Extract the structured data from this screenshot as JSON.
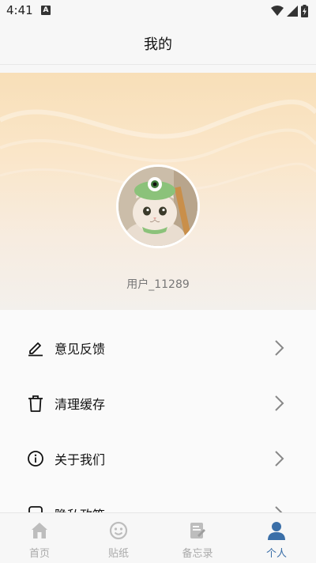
{
  "status_bar": {
    "time": "4:41",
    "notification_badge": "A",
    "icons": [
      "wifi-icon",
      "signal-icon",
      "battery-charging-icon"
    ]
  },
  "header": {
    "title": "我的"
  },
  "profile": {
    "username": "用户_11289"
  },
  "menu": {
    "items": [
      {
        "label": "意见反馈",
        "icon": "edit-pencil-icon"
      },
      {
        "label": "清理缓存",
        "icon": "trash-icon"
      },
      {
        "label": "关于我们",
        "icon": "info-icon"
      },
      {
        "label": "隐私政策",
        "icon": "document-icon"
      }
    ]
  },
  "bottom_nav": {
    "items": [
      {
        "label": "首页",
        "icon": "home-icon",
        "active": false
      },
      {
        "label": "贴纸",
        "icon": "sticker-icon",
        "active": false
      },
      {
        "label": "备忘录",
        "icon": "memo-icon",
        "active": false
      },
      {
        "label": "个人",
        "icon": "person-icon",
        "active": true
      }
    ]
  },
  "colors": {
    "accent": "#3b6fa8",
    "inactive": "#aaaaaa",
    "banner_top": "#f8dfb8"
  }
}
